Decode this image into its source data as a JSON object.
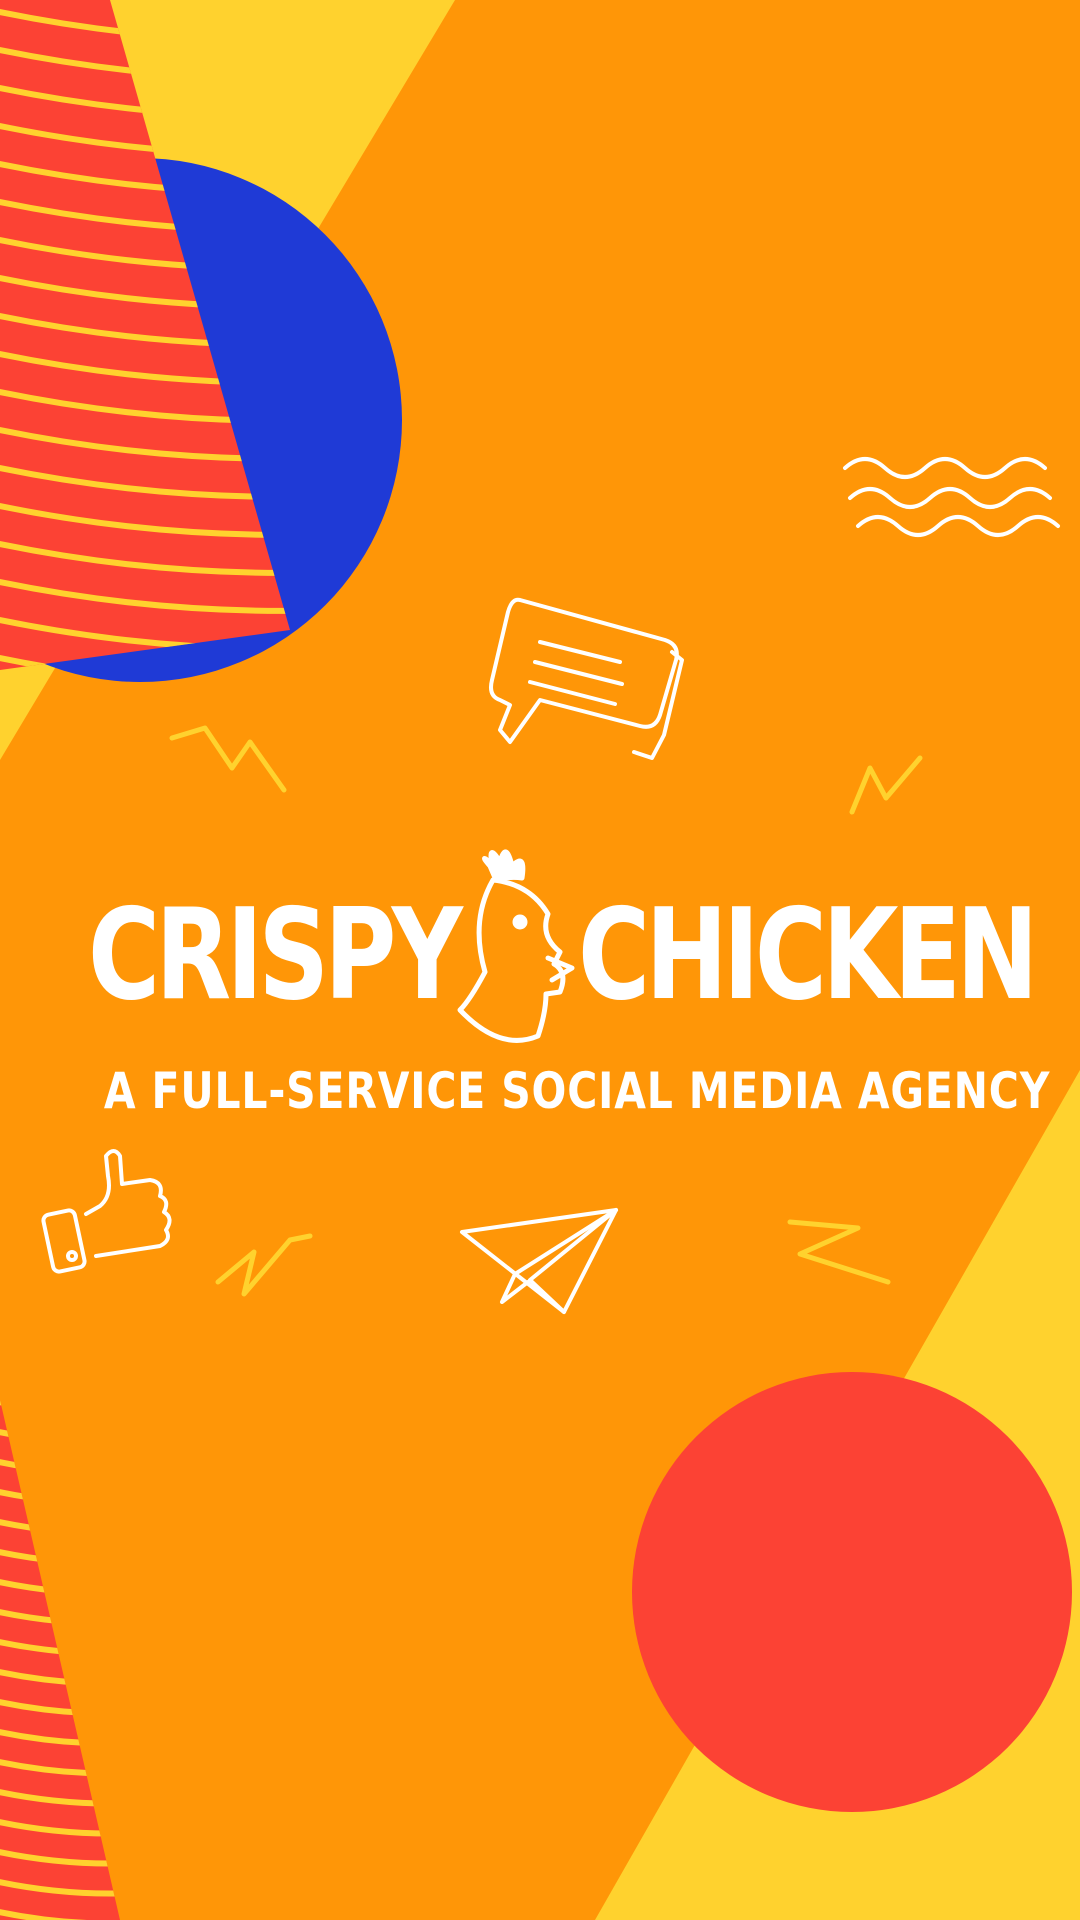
{
  "brand": {
    "word_left": "CRISPY",
    "word_right": "CHICKEN",
    "tagline": "A FULL-SERVICE SOCIAL MEDIA AGENCY"
  },
  "colors": {
    "background_orange": "#ff9607",
    "accent_yellow": "#ffd22e",
    "stripe_red": "#fc4234",
    "stripe_line": "#ffd22e",
    "circle_blue": "#1f3ad6",
    "circle_red": "#fc4234",
    "doodle_white": "#ffffff",
    "doodle_yellow": "#ffd22e"
  },
  "icons": {
    "logo_mascot": "chicken-head-icon",
    "chat": "chat-bubble-icon",
    "like": "thumbs-up-icon",
    "send": "paper-plane-icon",
    "waves": "wave-lines-icon",
    "zigzag": "zigzag-icon"
  }
}
